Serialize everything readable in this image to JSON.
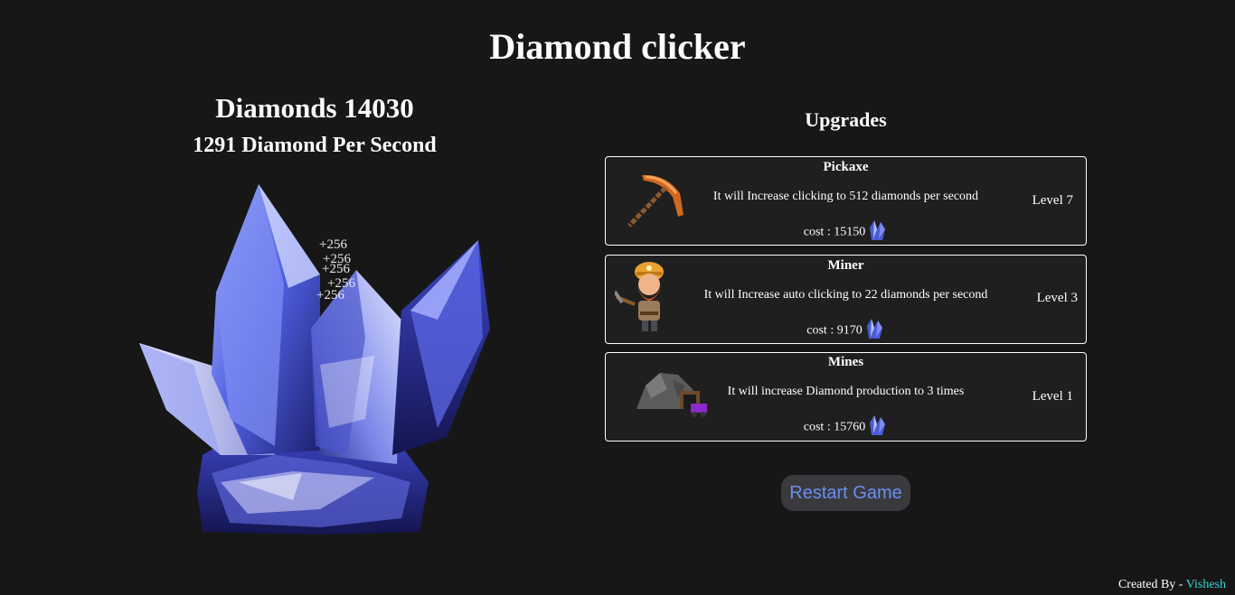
{
  "app": {
    "title": "Diamond clicker"
  },
  "stats": {
    "diamonds_label": "Diamonds 14030",
    "per_second_label": "1291 Diamond Per Second"
  },
  "click_popups": [
    "+256",
    "+256",
    "+256",
    "+256",
    "+256"
  ],
  "upgrades": {
    "heading": "Upgrades",
    "items": [
      {
        "name": "Pickaxe",
        "description": "It will Increase clicking to 512 diamonds per second",
        "cost": "cost : 15150",
        "level": "Level 7",
        "icon": "pickaxe-icon"
      },
      {
        "name": "Miner",
        "description": "It will Increase auto clicking to 22 diamonds per second",
        "cost": "cost : 9170",
        "level": "Level 3",
        "icon": "miner-icon"
      },
      {
        "name": "Mines",
        "description": "It will increase Diamond production to 3 times",
        "cost": "cost : 15760",
        "level": "Level 1",
        "icon": "mine-icon"
      }
    ]
  },
  "actions": {
    "restart_label": "Restart Game"
  },
  "footer": {
    "prefix": "Created By - ",
    "author": "Vishesh"
  },
  "colors": {
    "background": "#171717",
    "restart_text": "#6b8ff0",
    "author_link": "#33d6d6"
  }
}
